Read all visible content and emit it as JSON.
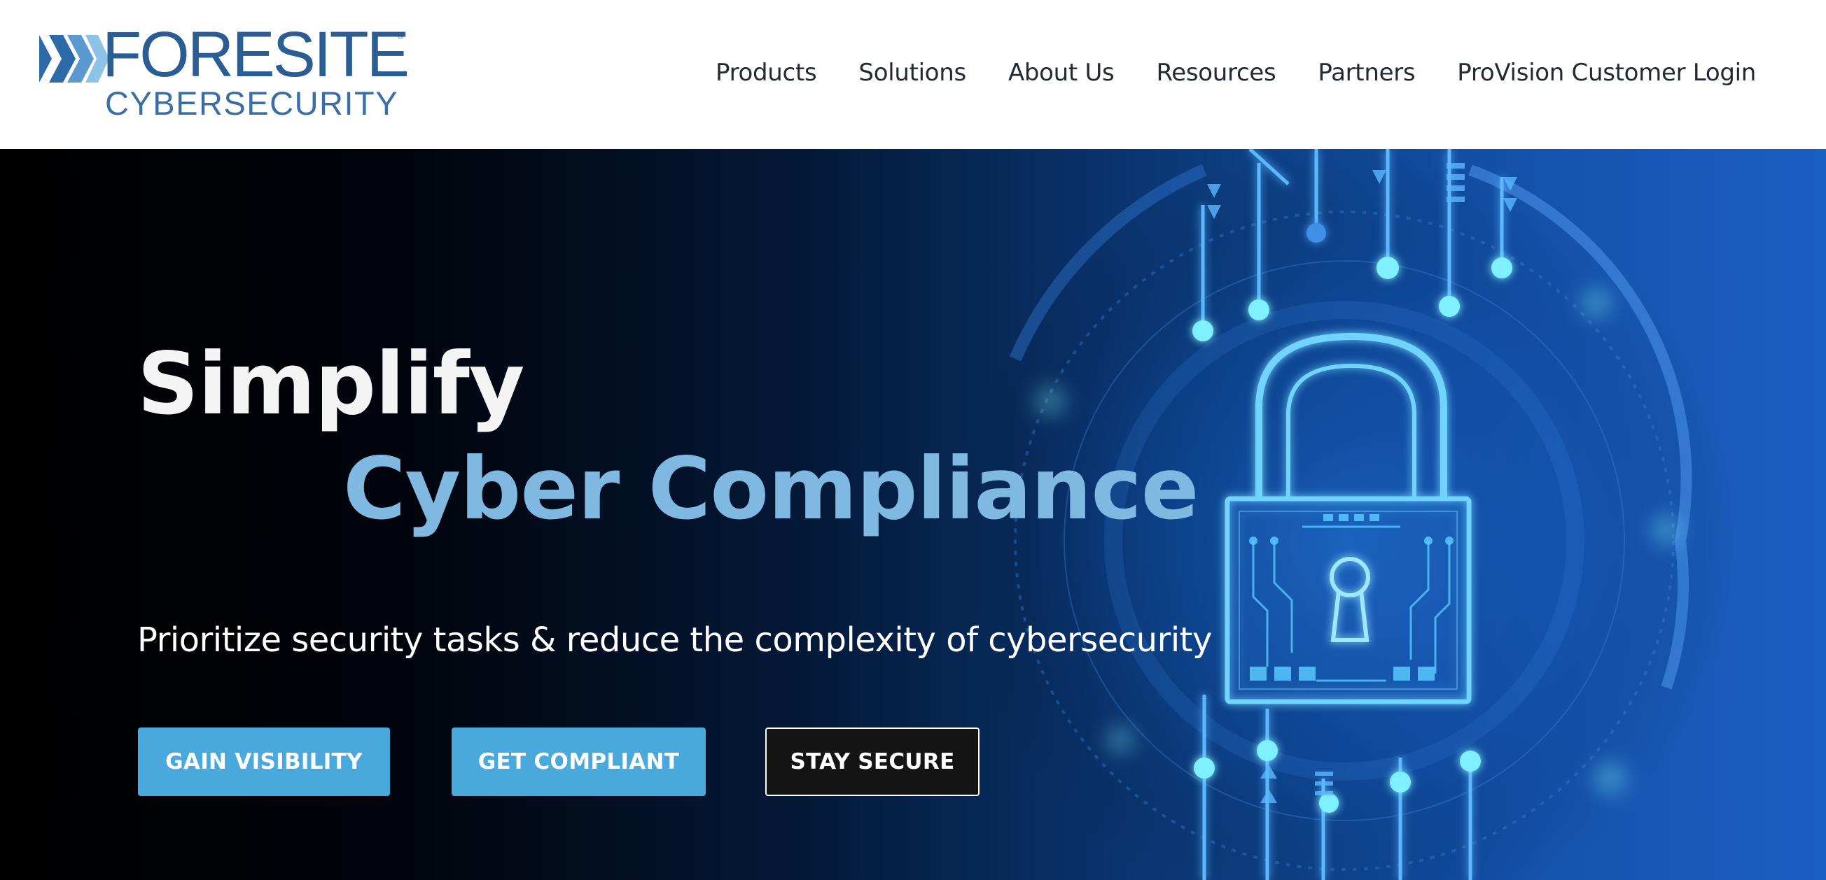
{
  "brand": {
    "name": "FORESITE",
    "tagline": "CYBERSECURITY",
    "registered_mark": "®",
    "colors": {
      "primary": "#2a5d93",
      "chevron_dark": "#2d6aa8",
      "chevron_light": "#7fb8e0"
    }
  },
  "nav": {
    "items": [
      {
        "label": "Products"
      },
      {
        "label": "Solutions"
      },
      {
        "label": "About Us"
      },
      {
        "label": "Resources"
      },
      {
        "label": "Partners"
      },
      {
        "label": "ProVision Customer Login"
      }
    ]
  },
  "hero": {
    "title_line1": "Simplify",
    "title_line2": "Cyber Compliance",
    "subtitle": "Prioritize security tasks & reduce the complexity of cybersecurity",
    "buttons": [
      {
        "label": "GAIN VISIBILITY"
      },
      {
        "label": "GET COMPLIANT"
      },
      {
        "label": "STAY SECURE"
      }
    ],
    "image_icon": "padlock-circuit-icon",
    "colors": {
      "accent": "#4aa9dc",
      "title_highlight": "#7fb8e0",
      "glow": "#7ff0ff"
    }
  }
}
